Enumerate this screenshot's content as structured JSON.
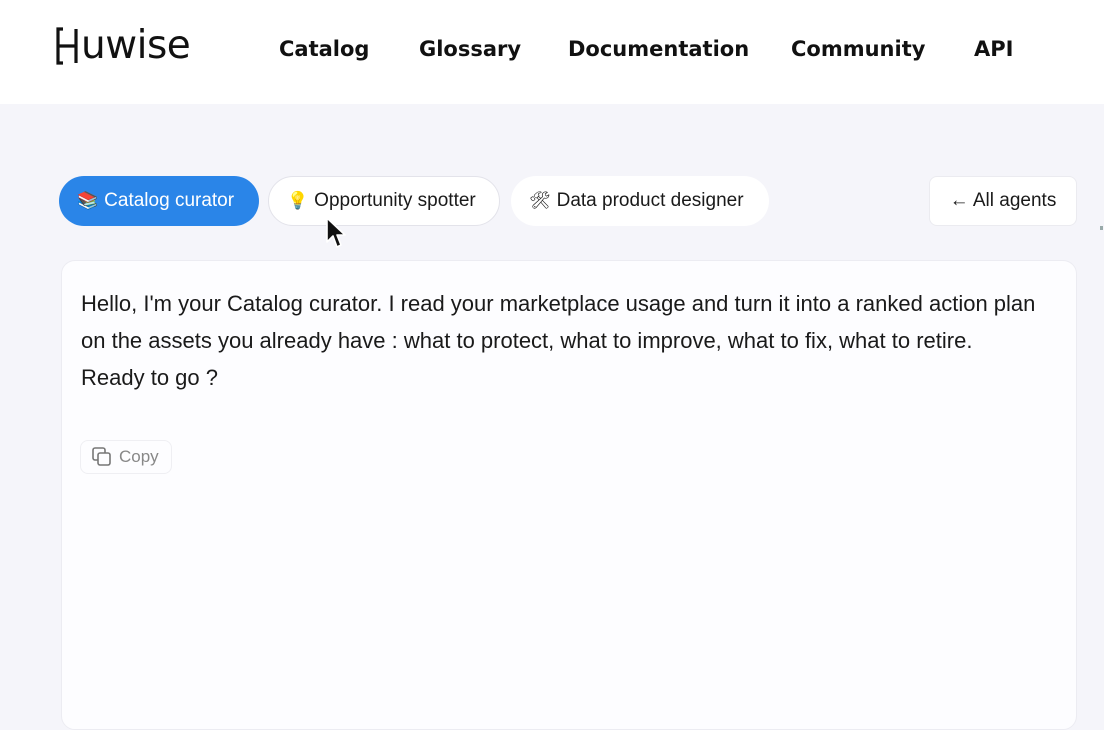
{
  "header": {
    "logo_text": "uwise",
    "nav": [
      {
        "label": "Catalog"
      },
      {
        "label": "Glossary"
      },
      {
        "label": "Documentation"
      },
      {
        "label": "Community"
      },
      {
        "label": "API"
      }
    ]
  },
  "agents": {
    "tabs": [
      {
        "emoji": "📚",
        "label": "Catalog curator",
        "active": true
      },
      {
        "emoji": "💡",
        "label": "Opportunity spotter",
        "active": false
      },
      {
        "emoji": "🛠",
        "label": "Data product designer",
        "active": false
      }
    ],
    "all_agents_label": "← All agents"
  },
  "chat": {
    "message_lines": [
      "Hello, I'm your Catalog curator. I read your marketplace usage and turn it into a ranked action plan on the assets you already have : what to protect, what to improve, what to fix, what to retire.",
      "Ready to go ?"
    ],
    "copy_label": "Copy"
  },
  "colors": {
    "accent": "#2a85e8",
    "background": "#f5f5fa",
    "panel": "#fdfdff"
  },
  "icons": {
    "logo": "bracket-h-logo-icon",
    "copy": "copy-icon",
    "cursor": "mouse-pointer-icon"
  }
}
